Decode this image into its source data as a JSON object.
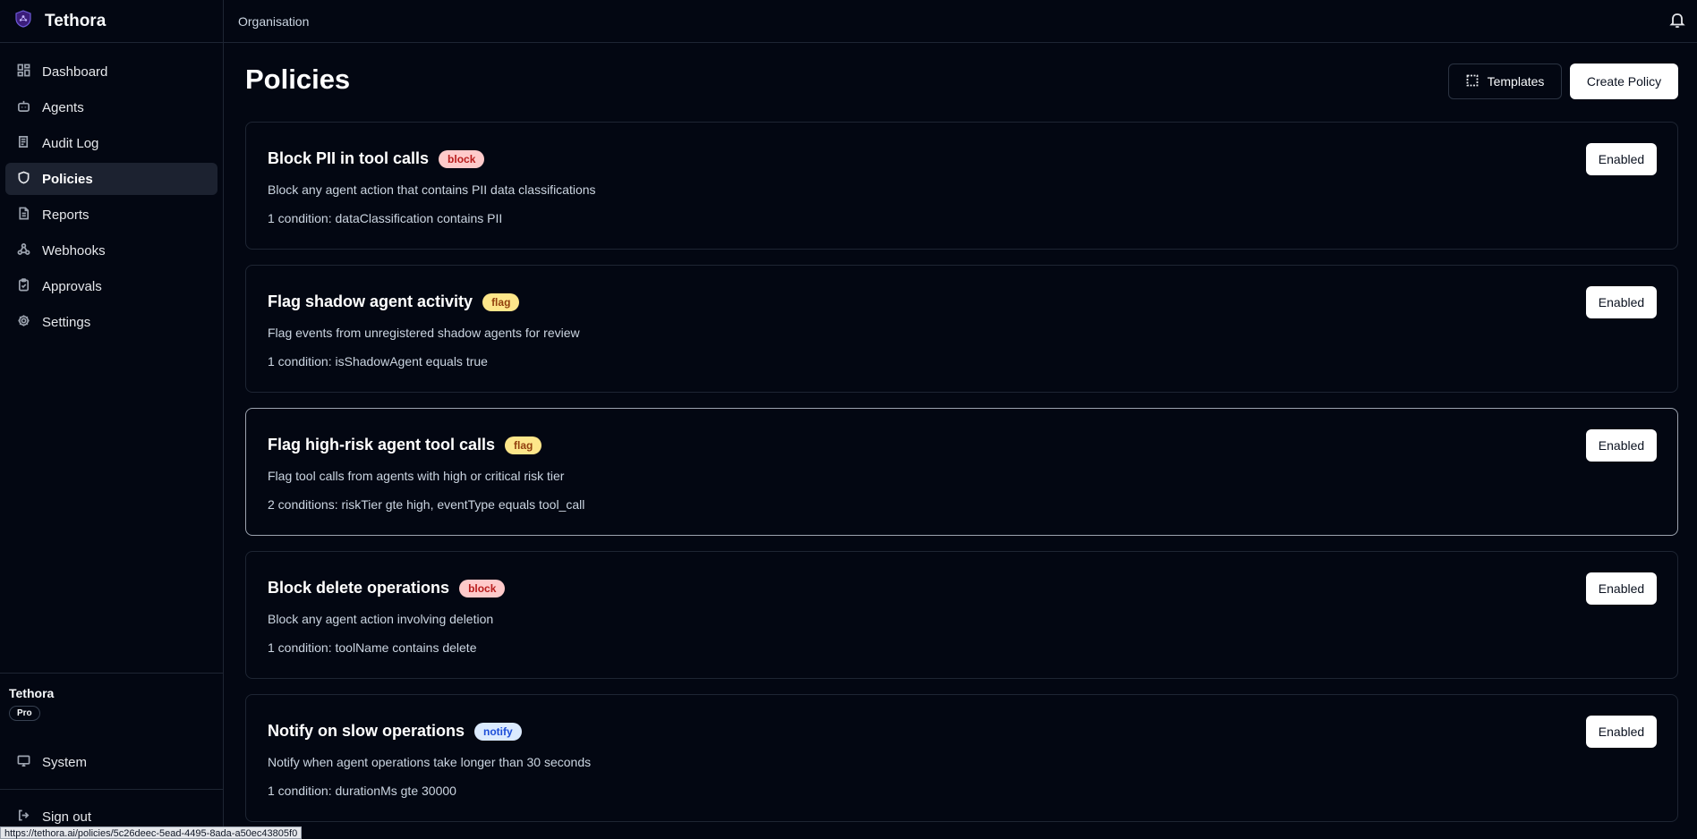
{
  "app": {
    "name": "Tethora"
  },
  "sidebar": {
    "items": [
      {
        "label": "Dashboard",
        "icon": "dashboard-icon",
        "active": false
      },
      {
        "label": "Agents",
        "icon": "bot-icon",
        "active": false
      },
      {
        "label": "Audit Log",
        "icon": "audit-log-icon",
        "active": false
      },
      {
        "label": "Policies",
        "icon": "shield-icon",
        "active": true
      },
      {
        "label": "Reports",
        "icon": "document-icon",
        "active": false
      },
      {
        "label": "Webhooks",
        "icon": "webhook-icon",
        "active": false
      },
      {
        "label": "Approvals",
        "icon": "clipboard-check-icon",
        "active": false
      },
      {
        "label": "Settings",
        "icon": "gear-icon",
        "active": false
      }
    ],
    "org": {
      "name": "Tethora",
      "plan": "Pro"
    },
    "system_label": "System",
    "signout_label": "Sign out"
  },
  "topbar": {
    "breadcrumb": "Organisation"
  },
  "page": {
    "title": "Policies",
    "templates_label": "Templates",
    "create_label": "Create Policy"
  },
  "policies": [
    {
      "title": "Block PII in tool calls",
      "tag": "block",
      "description": "Block any agent action that contains PII data classifications",
      "conditions": "1 condition: dataClassification contains PII",
      "status": "Enabled"
    },
    {
      "title": "Flag shadow agent activity",
      "tag": "flag",
      "description": "Flag events from unregistered shadow agents for review",
      "conditions": "1 condition: isShadowAgent equals true",
      "status": "Enabled"
    },
    {
      "title": "Flag high-risk agent tool calls",
      "tag": "flag",
      "description": "Flag tool calls from agents with high or critical risk tier",
      "conditions": "2 conditions: riskTier gte high, eventType equals tool_call",
      "status": "Enabled"
    },
    {
      "title": "Block delete operations",
      "tag": "block",
      "description": "Block any agent action involving deletion",
      "conditions": "1 condition: toolName contains delete",
      "status": "Enabled"
    },
    {
      "title": "Notify on slow operations",
      "tag": "notify",
      "description": "Notify when agent operations take longer than 30 seconds",
      "conditions": "1 condition: durationMs gte 30000",
      "status": "Enabled"
    }
  ],
  "status_bar": {
    "url": "https://tethora.ai/policies/5c26deec-5ead-4495-8ada-a50ec43805f0"
  },
  "colors": {
    "background": "#030712",
    "tag_block": "#fecaca",
    "tag_flag": "#fde68a",
    "tag_notify": "#dbeafe"
  }
}
